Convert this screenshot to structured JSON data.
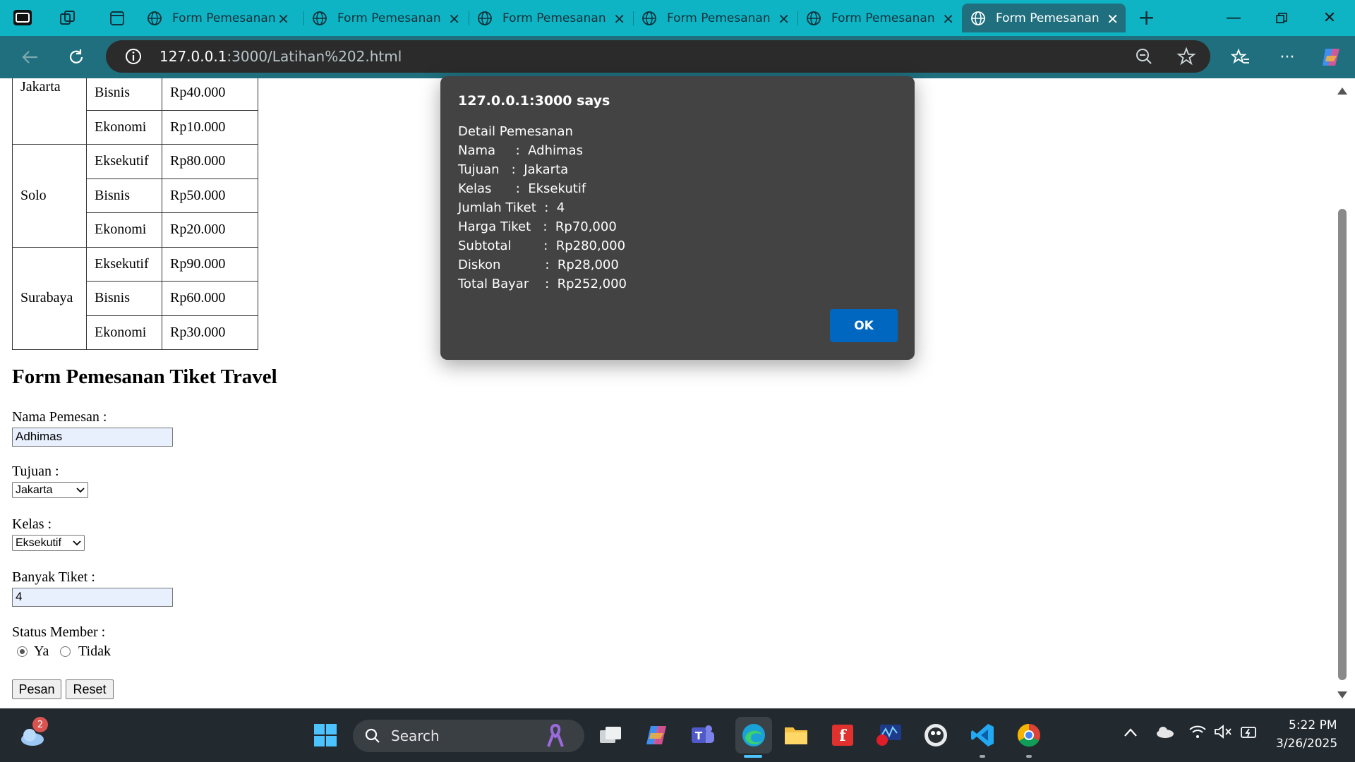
{
  "browser": {
    "tabs": [
      {
        "title": "Form Pemesanan"
      },
      {
        "title": "Form Pemesanan"
      },
      {
        "title": "Form Pemesanan"
      },
      {
        "title": "Form Pemesanan"
      },
      {
        "title": "Form Pemesanan"
      },
      {
        "title": "Form Pemesanan"
      }
    ],
    "url_host": "127.0.0.1",
    "url_rest": ":3000/Latihan%202.html"
  },
  "price_table": {
    "rows": [
      {
        "city": "Jakarta",
        "class": "Bisnis",
        "price": "Rp40.000"
      },
      {
        "city": "",
        "class": "Ekonomi",
        "price": "Rp10.000"
      },
      {
        "city": "Solo",
        "class": "Eksekutif",
        "price": "Rp80.000"
      },
      {
        "city": "",
        "class": "Bisnis",
        "price": "Rp50.000"
      },
      {
        "city": "",
        "class": "Ekonomi",
        "price": "Rp20.000"
      },
      {
        "city": "Surabaya",
        "class": "Eksekutif",
        "price": "Rp90.000"
      },
      {
        "city": "",
        "class": "Bisnis",
        "price": "Rp60.000"
      },
      {
        "city": "",
        "class": "Ekonomi",
        "price": "Rp30.000"
      }
    ]
  },
  "form": {
    "title": "Form Pemesanan Tiket Travel",
    "name_label": "Nama Pemesan :",
    "name_value": "Adhimas",
    "dest_label": "Tujuan :",
    "dest_value": "Jakarta",
    "class_label": "Kelas :",
    "class_value": "Eksekutif",
    "qty_label": "Banyak Tiket :",
    "qty_value": "4",
    "member_label": "Status Member :",
    "member_yes": "Ya",
    "member_no": "Tidak",
    "submit_label": "Pesan",
    "reset_label": "Reset"
  },
  "dialog": {
    "title": "127.0.0.1:3000 says",
    "lines": [
      "Detail Pemesanan",
      "Nama     :  Adhimas",
      "Tujuan   :  Jakarta",
      "Kelas      :  Eksekutif",
      "Jumlah Tiket  :  4",
      "Harga Tiket   :  Rp70,000",
      "Subtotal        :  Rp280,000",
      "Diskon           :  Rp28,000",
      "Total Bayar    :  Rp252,000"
    ],
    "ok_label": "OK"
  },
  "taskbar": {
    "search_placeholder": "Search",
    "weather_badge": "2",
    "time": "5:22 PM",
    "date": "3/26/2025"
  }
}
